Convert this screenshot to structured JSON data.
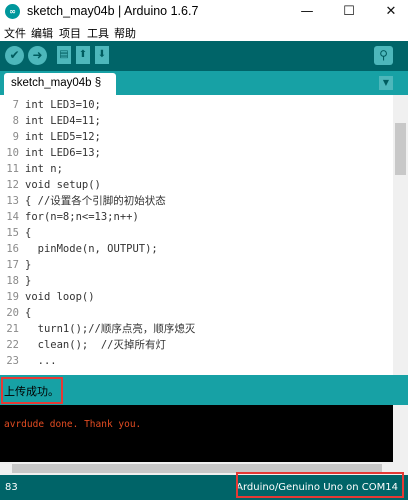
{
  "window": {
    "title": "sketch_may04b | Arduino 1.6.7",
    "app_icon_text": "∞",
    "minimize": "—",
    "maximize": "☐",
    "close": "✕"
  },
  "menu": [
    "文件",
    "编辑",
    "项目",
    "工具",
    "帮助"
  ],
  "toolbar": {
    "verify_icon": "✔",
    "upload_icon": "➜",
    "new_icon": "▤",
    "open_icon": "⬆",
    "save_icon": "⬇",
    "serial_monitor_icon": "⚲"
  },
  "tabs": [
    {
      "label": "sketch_may04b §"
    }
  ],
  "tab_menu_icon": "▼",
  "editor": {
    "lines": [
      {
        "n": "7",
        "text": "int LED3=10;"
      },
      {
        "n": "8",
        "text": "int LED4=11;"
      },
      {
        "n": "9",
        "text": "int LED5=12;"
      },
      {
        "n": "10",
        "text": "int LED6=13;"
      },
      {
        "n": "11",
        "text": "int n;"
      },
      {
        "n": "12",
        "text": "void setup()"
      },
      {
        "n": "13",
        "text": "{ //设置各个引脚的初始状态"
      },
      {
        "n": "14",
        "text": "for(n=8;n<=13;n++)"
      },
      {
        "n": "15",
        "text": "{"
      },
      {
        "n": "16",
        "text": "  pinMode(n, OUTPUT);"
      },
      {
        "n": "17",
        "text": "}"
      },
      {
        "n": "18",
        "text": "}"
      },
      {
        "n": "19",
        "text": "void loop()"
      },
      {
        "n": "20",
        "text": "{"
      },
      {
        "n": "21",
        "text": "  turn1();//顺序点亮，顺序熄灭"
      },
      {
        "n": "22",
        "text": "  clean();  //灭掉所有灯"
      },
      {
        "n": "23",
        "text": "  ..."
      }
    ]
  },
  "status": {
    "message": "上传成功。"
  },
  "console": {
    "output": "avrdude done.  Thank you."
  },
  "bottom": {
    "line_number": "83",
    "board": "Arduino/Genuino Uno on COM14"
  },
  "colors": {
    "toolbar": "#006468",
    "tabstrip": "#17a1a5",
    "highlight": "#e53935"
  }
}
